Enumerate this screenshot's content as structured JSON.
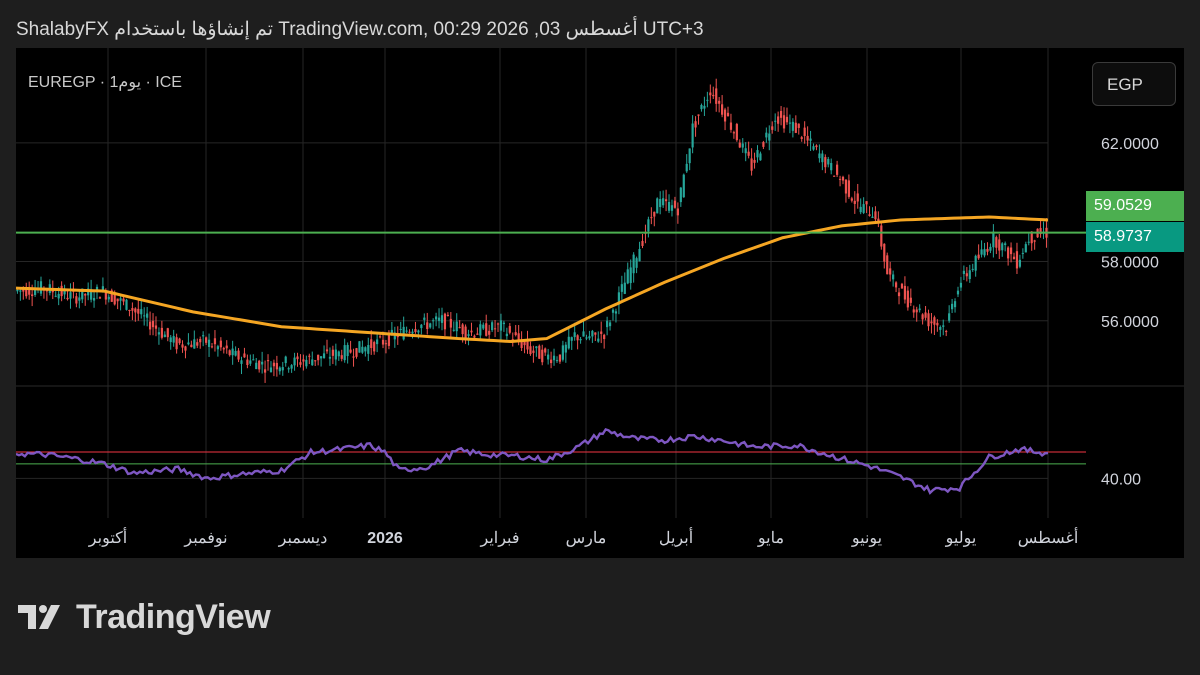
{
  "header": {
    "text": "ShalabyFX تم إنشاؤها باستخدام TradingView.com, 00:29 2026 ,03 أغسطس UTC+3"
  },
  "legend": {
    "text": "EUREGP · 1يوم · ICE"
  },
  "currency_button": {
    "label": "EGP"
  },
  "price_tags": [
    {
      "label": "59.0529",
      "color": "#4caf50",
      "value": 59.0529
    },
    {
      "label": "58.9737",
      "color": "#089981",
      "value": 58.9737
    }
  ],
  "logo": {
    "text": "TradingView"
  },
  "colors": {
    "up": "#26a69a",
    "down": "#ef5350",
    "ma": "#f5a623",
    "rsi": "#7e57c2",
    "hline_price": "#4caf50",
    "rsi_upper": "#f23645",
    "rsi_lower": "#4caf50",
    "price_label": "#d1d4dc"
  },
  "chart_data": {
    "type": "candlestick",
    "price_axis": {
      "min": 53.8,
      "max": 65.2,
      "ticks": [
        {
          "label": "62.0000",
          "value": 62
        },
        {
          "label": "58.0000",
          "value": 58
        },
        {
          "label": "56.0000",
          "value": 56
        }
      ]
    },
    "x_labels": [
      "أكتوبر",
      "نوفمبر",
      "ديسمبر",
      "2026",
      "فبراير",
      "مارس",
      "أبريل",
      "مايو",
      "يونيو",
      "يوليو",
      "أغسطس"
    ],
    "x_label_bold": [
      false,
      false,
      false,
      true,
      false,
      false,
      false,
      false,
      false,
      false,
      false
    ],
    "price_path": [
      [
        0,
        57
      ],
      [
        10,
        57.1
      ],
      [
        20,
        56.8
      ],
      [
        30,
        57
      ],
      [
        40,
        56.4
      ],
      [
        55,
        55.2
      ],
      [
        65,
        55.3
      ],
      [
        75,
        54.8
      ],
      [
        85,
        54.5
      ],
      [
        95,
        54.6
      ],
      [
        105,
        54.8
      ],
      [
        115,
        55
      ],
      [
        125,
        55.3
      ],
      [
        135,
        55.8
      ],
      [
        145,
        56
      ],
      [
        155,
        55.6
      ],
      [
        165,
        55.8
      ],
      [
        175,
        55
      ],
      [
        180,
        54.8
      ],
      [
        185,
        54.8
      ],
      [
        190,
        55.5
      ],
      [
        195,
        55.4
      ],
      [
        200,
        55.6
      ],
      [
        210,
        58
      ],
      [
        218,
        60
      ],
      [
        225,
        59.8
      ],
      [
        230,
        62.5
      ],
      [
        236,
        63.8
      ],
      [
        242,
        62.8
      ],
      [
        250,
        61.2
      ],
      [
        258,
        62.9
      ],
      [
        265,
        62.5
      ],
      [
        272,
        61.7
      ],
      [
        280,
        60.8
      ],
      [
        286,
        59.9
      ],
      [
        292,
        59.6
      ],
      [
        296,
        57.6
      ],
      [
        302,
        56.8
      ],
      [
        310,
        56
      ],
      [
        316,
        55.8
      ],
      [
        320,
        57.2
      ],
      [
        326,
        58
      ],
      [
        332,
        58.8
      ],
      [
        336,
        58.4
      ],
      [
        340,
        58
      ],
      [
        344,
        58.8
      ],
      [
        349,
        58.97
      ]
    ],
    "price_noise_seed": 7,
    "ma_path": [
      [
        0,
        57.1
      ],
      [
        30,
        57
      ],
      [
        60,
        56.3
      ],
      [
        90,
        55.8
      ],
      [
        120,
        55.6
      ],
      [
        150,
        55.4
      ],
      [
        168,
        55.3
      ],
      [
        180,
        55.4
      ],
      [
        200,
        56.4
      ],
      [
        220,
        57.3
      ],
      [
        240,
        58.1
      ],
      [
        260,
        58.8
      ],
      [
        280,
        59.2
      ],
      [
        300,
        59.4
      ],
      [
        330,
        59.5
      ],
      [
        350,
        59.4
      ]
    ],
    "horizontal_level": 58.9737,
    "rsi": {
      "min": 25,
      "max": 75,
      "ticks": [
        {
          "label": "40.00",
          "value": 40
        }
      ],
      "upper_level": 50,
      "lower_level": 45.5,
      "path": [
        [
          0,
          49.5
        ],
        [
          10,
          49
        ],
        [
          20,
          47.5
        ],
        [
          30,
          45.5
        ],
        [
          40,
          42
        ],
        [
          55,
          43.5
        ],
        [
          65,
          40
        ],
        [
          75,
          41.5
        ],
        [
          90,
          43
        ],
        [
          100,
          49.8
        ],
        [
          110,
          51
        ],
        [
          120,
          52.5
        ],
        [
          125,
          50
        ],
        [
          130,
          43
        ],
        [
          140,
          44.5
        ],
        [
          150,
          50.5
        ],
        [
          160,
          49
        ],
        [
          170,
          48.5
        ],
        [
          180,
          47
        ],
        [
          190,
          51.5
        ],
        [
          200,
          58
        ],
        [
          210,
          55
        ],
        [
          220,
          54.5
        ],
        [
          230,
          56
        ],
        [
          240,
          54.3
        ],
        [
          250,
          52
        ],
        [
          265,
          52.5
        ],
        [
          280,
          47.5
        ],
        [
          290,
          44.5
        ],
        [
          300,
          40.5
        ],
        [
          310,
          35.5
        ],
        [
          320,
          36.5
        ],
        [
          330,
          48
        ],
        [
          340,
          51
        ],
        [
          350,
          49.5
        ]
      ]
    }
  }
}
